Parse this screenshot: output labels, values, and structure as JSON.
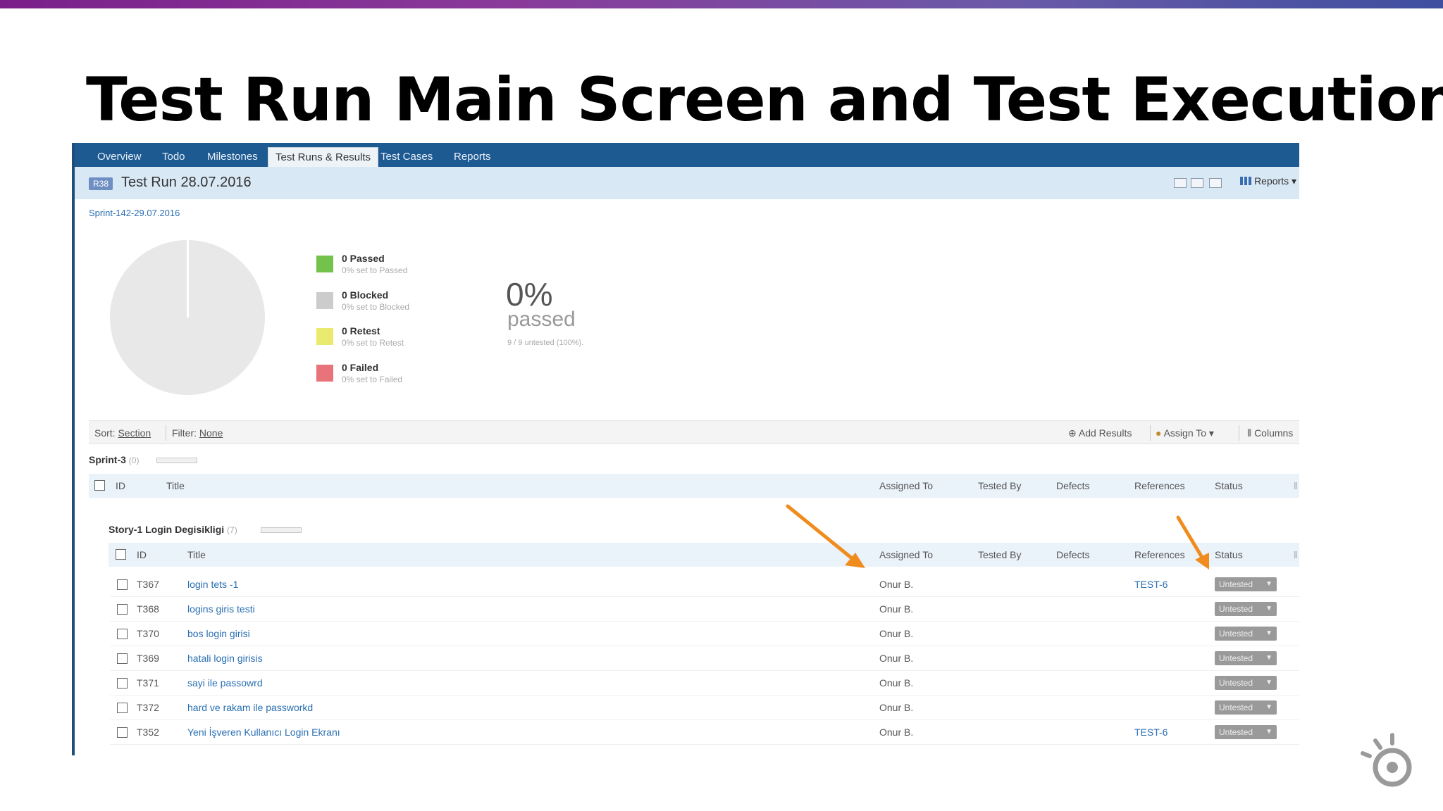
{
  "slide": {
    "title": "Test Run Main Screen and Test Execution"
  },
  "nav": {
    "tabs": [
      "Overview",
      "Todo",
      "Milestones",
      "Test Runs & Results",
      "Test Cases",
      "Reports"
    ],
    "active_tab": "Test Runs & Results"
  },
  "run": {
    "badge": "R38",
    "title": "Test Run 28.07.2016",
    "milestone": "Sprint-142-29.07.2016",
    "reports_label": "Reports ▾"
  },
  "stats": {
    "items": [
      {
        "label": "0 Passed",
        "sub": "0% set to Passed",
        "color": "#73c24b"
      },
      {
        "label": "0 Blocked",
        "sub": "0% set to Blocked",
        "color": "#cccccc"
      },
      {
        "label": "0 Retest",
        "sub": "0% set to Retest",
        "color": "#eaea6e"
      },
      {
        "label": "0 Failed",
        "sub": "0% set to Failed",
        "color": "#e8737a"
      }
    ],
    "percent": "0%",
    "percent_word": "passed",
    "note": "9 / 9 untested (100%)."
  },
  "toolbar": {
    "sort_prefix": "Sort:",
    "sort_value": "Section",
    "filter_prefix": "Filter:",
    "filter_value": "None",
    "add_results": "Add Results",
    "assign_to": "Assign To ▾",
    "columns": "Columns"
  },
  "sections": {
    "parent": {
      "name": "Sprint-3",
      "count": "(0)"
    },
    "child": {
      "name": "Story-1 Login Degisikligi",
      "count": "(7)"
    }
  },
  "columns": {
    "id": "ID",
    "title": "Title",
    "assigned_to": "Assigned To",
    "tested_by": "Tested By",
    "defects": "Defects",
    "references": "References",
    "status": "Status"
  },
  "tests": [
    {
      "id": "T367",
      "title": "login tets -1",
      "assigned": "Onur B.",
      "reference": "TEST-6",
      "status": "Untested"
    },
    {
      "id": "T368",
      "title": "logins giris testi",
      "assigned": "Onur B.",
      "reference": "",
      "status": "Untested"
    },
    {
      "id": "T370",
      "title": "bos login girisi",
      "assigned": "Onur B.",
      "reference": "",
      "status": "Untested"
    },
    {
      "id": "T369",
      "title": "hatali login girisis",
      "assigned": "Onur B.",
      "reference": "",
      "status": "Untested"
    },
    {
      "id": "T371",
      "title": "sayi ile passowrd",
      "assigned": "Onur B.",
      "reference": "",
      "status": "Untested"
    },
    {
      "id": "T372",
      "title": "hard ve rakam ile passworkd",
      "assigned": "Onur B.",
      "reference": "",
      "status": "Untested"
    },
    {
      "id": "T352",
      "title": "Yeni İşveren Kullanıcı Login Ekranı",
      "assigned": "Onur B.",
      "reference": "TEST-6",
      "status": "Untested"
    }
  ],
  "colors": {
    "nav_bg": "#1d5a91",
    "header_bg": "#d9e8f5",
    "link": "#2a6fb3",
    "annotation_arrow": "#f08c1e"
  }
}
